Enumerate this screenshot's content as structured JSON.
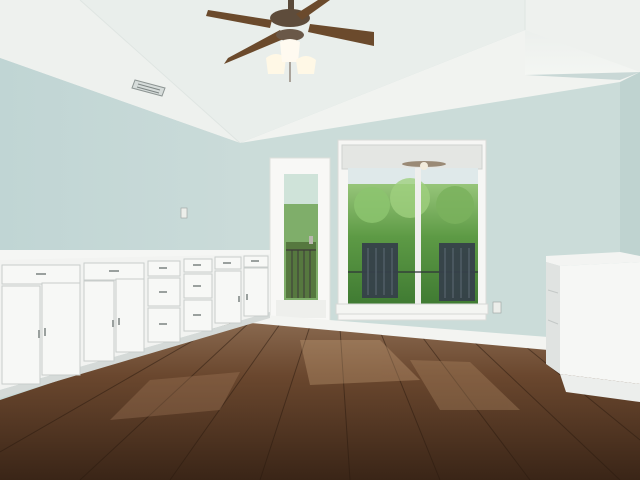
{
  "scene": {
    "description_visible_text": "",
    "colors": {
      "ceiling": "#eef1ee",
      "wall_left": "#c4d8d6",
      "wall_back": "#cbdcd9",
      "wall_right": "#c7dad7",
      "cabinet": "#f6f7f5",
      "cabinet_shadow": "#d9dddb",
      "baseboard": "#f4f5f3",
      "floor_dark": "#3b2618",
      "floor_mid": "#6e4a30",
      "floor_light": "#9a7658",
      "fan_blade": "#6b4a2c",
      "fan_body": "#5a4a3a",
      "light_glass": "#fff8e6",
      "foliage": "#5f9a48",
      "foliage_light": "#9fcf7c",
      "sky": "#e8f2f4",
      "chair": "#38404a",
      "door_frame": "#f7f7f5"
    },
    "icons": [
      "ceiling-fan-icon",
      "air-vent-icon",
      "light-switch-icon",
      "outlet-icon"
    ]
  }
}
